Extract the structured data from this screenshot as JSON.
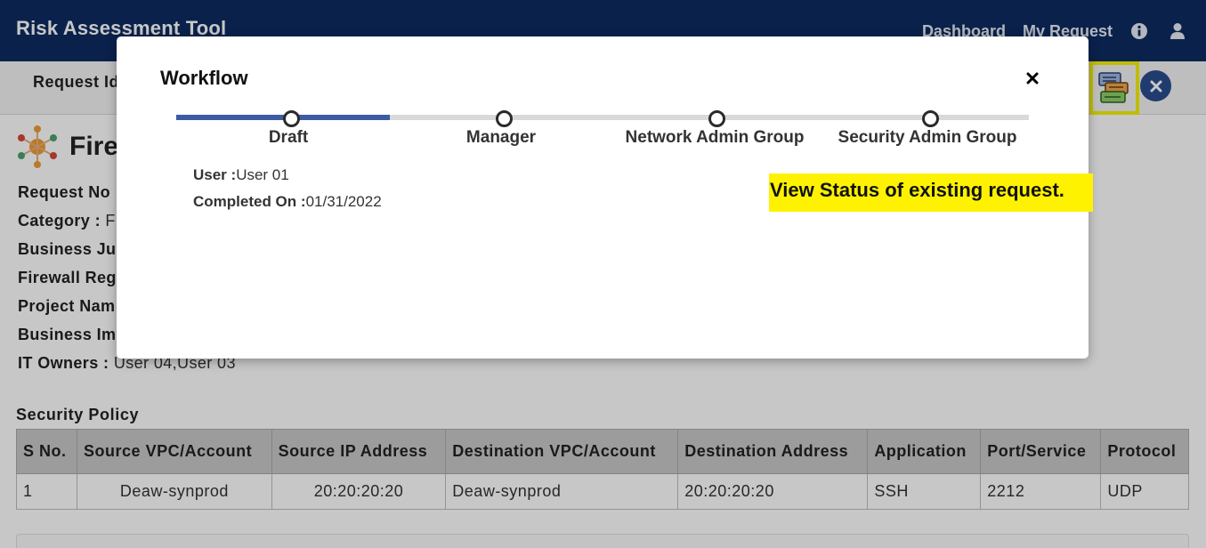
{
  "header": {
    "app_title": "Risk Assessment Tool",
    "nav": {
      "dashboard": "Dashboard",
      "my_request": "My Request"
    },
    "icons": [
      "info-icon",
      "user-icon"
    ]
  },
  "subheader": {
    "request_id_label": "Request Id"
  },
  "page": {
    "heading": "Firewall Request",
    "details": [
      {
        "label": "Request No",
        "value": ""
      },
      {
        "label": "Category : ",
        "value": "F"
      },
      {
        "label": "Business Ju",
        "value": ""
      },
      {
        "label": "Firewall Reg",
        "value": ""
      },
      {
        "label": "Project Nam",
        "value": ""
      },
      {
        "label": "Business Im",
        "value": ""
      },
      {
        "label": "IT Owners : ",
        "value": "User 04,User 03"
      }
    ],
    "security_policy": {
      "title": "Security Policy",
      "columns": [
        "S No.",
        "Source VPC/Account",
        "Source IP Address",
        "Destination VPC/Account",
        "Destination Address",
        "Application",
        "Port/Service",
        "Protocol"
      ],
      "rows": [
        [
          "1",
          "Deaw-synprod",
          "20:20:20:20",
          "Deaw-synprod",
          "20:20:20:20",
          "SSH",
          "2212",
          "UDP"
        ]
      ]
    }
  },
  "modal": {
    "title": "Workflow",
    "close_glyph": "×",
    "progress_fraction": 0.25,
    "steps": [
      {
        "label": "Draft",
        "completed": true
      },
      {
        "label": "Manager",
        "completed": false
      },
      {
        "label": "Network Admin Group",
        "completed": false
      },
      {
        "label": "Security Admin Group",
        "completed": false
      }
    ],
    "info": {
      "user_label": "User :",
      "user_value": "User 01",
      "completed_label": "Completed On :",
      "completed_value": "01/31/2022"
    }
  },
  "callout": {
    "text": "View Status of existing request."
  },
  "colors": {
    "header_bg": "#0c2b60",
    "accent": "#3d5ba3",
    "highlight": "#fff200"
  }
}
